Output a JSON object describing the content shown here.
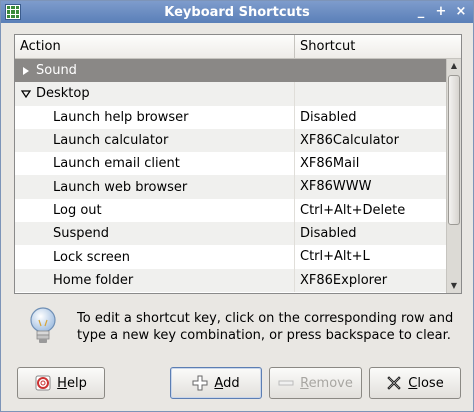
{
  "window": {
    "title": "Keyboard Shortcuts",
    "controls": [
      "_",
      "+",
      "×"
    ]
  },
  "tree": {
    "headers": {
      "action": "Action",
      "shortcut": "Shortcut"
    },
    "rows": [
      {
        "action": "Sound",
        "shortcut": "",
        "type": "group",
        "expanded": false,
        "selected": true
      },
      {
        "action": "Desktop",
        "shortcut": "",
        "type": "group",
        "expanded": true,
        "selected": false
      },
      {
        "action": "Launch help browser",
        "shortcut": "Disabled",
        "type": "item"
      },
      {
        "action": "Launch calculator",
        "shortcut": "XF86Calculator",
        "type": "item"
      },
      {
        "action": "Launch email client",
        "shortcut": "XF86Mail",
        "type": "item"
      },
      {
        "action": "Launch web browser",
        "shortcut": "XF86WWW",
        "type": "item"
      },
      {
        "action": "Log out",
        "shortcut": "Ctrl+Alt+Delete",
        "type": "item"
      },
      {
        "action": "Suspend",
        "shortcut": "Disabled",
        "type": "item"
      },
      {
        "action": "Lock screen",
        "shortcut": "Ctrl+Alt+L",
        "type": "item"
      },
      {
        "action": "Home folder",
        "shortcut": "XF86Explorer",
        "type": "item"
      }
    ]
  },
  "info": {
    "text": "To edit a shortcut key, click on the corresponding row and type a new key combination, or press backspace to clear."
  },
  "buttons": {
    "help": {
      "mnemonic": "H",
      "rest": "elp"
    },
    "add": {
      "mnemonic": "A",
      "rest": "dd"
    },
    "remove": {
      "mnemonic": "R",
      "rest": "emove",
      "disabled": true
    },
    "close": {
      "mnemonic": "C",
      "rest": "lose"
    }
  },
  "colors": {
    "titlebar": "#6b8cc2",
    "selected_row": "#8a8886",
    "add_icon": "#7a9a3a",
    "close_icon": "#222222"
  }
}
